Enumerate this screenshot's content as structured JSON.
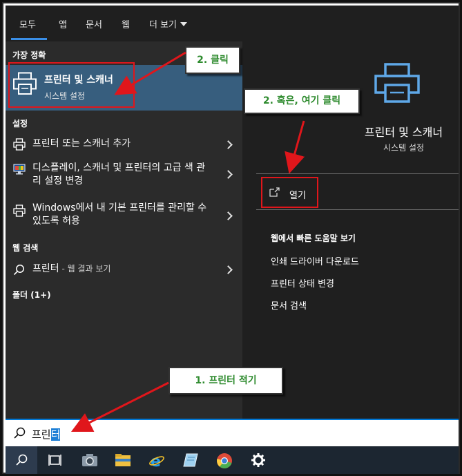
{
  "tabs": [
    {
      "label": "모두",
      "active": true
    },
    {
      "label": "앱"
    },
    {
      "label": "문서"
    },
    {
      "label": "웹"
    },
    {
      "label": "더 보기"
    }
  ],
  "left": {
    "best_match_header": "가장 정확",
    "best_match": {
      "title": "프린터 및 스캐너",
      "subtitle": "시스템 설정"
    },
    "settings_header": "설정",
    "settings_items": [
      {
        "text": "프린터 또는 스캐너 추가"
      },
      {
        "text": "디스플레이, 스캐너 및 프린터의 고급 색 관리 설정 변경"
      },
      {
        "text": "Windows에서 내 기본 프린터를 관리할 수 있도록 허용"
      }
    ],
    "web_header": "웹 검색",
    "web_item": {
      "query": "프린터",
      "suffix": " - 웹 결과 보기"
    },
    "folders_header": "폴더 (1+)"
  },
  "right": {
    "title": "프린터 및 스캐너",
    "subtitle": "시스템 설정",
    "open_label": "열기",
    "web_help_header": "웹에서 빠른 도움말 보기",
    "web_links": [
      "인쇄 드라이버 다운로드",
      "프린터 상태 변경",
      "문서 검색"
    ]
  },
  "search": {
    "typed": "프린",
    "selected": "터"
  },
  "annotations": {
    "step1": "1. 프린터 적기",
    "step2a": "2. 클릭",
    "step2b": "2. 혹은, 여기 클릭"
  },
  "colors": {
    "accent": "#0078d7",
    "highlight": "#375e7e",
    "annotation_red": "#e0161b",
    "annotation_text": "#2e8b2e"
  },
  "taskbar_icons": [
    "search-icon",
    "task-view-icon",
    "camera-icon",
    "file-explorer-icon",
    "internet-explorer-icon",
    "notepad-icon",
    "chrome-icon",
    "settings-gear-icon"
  ]
}
